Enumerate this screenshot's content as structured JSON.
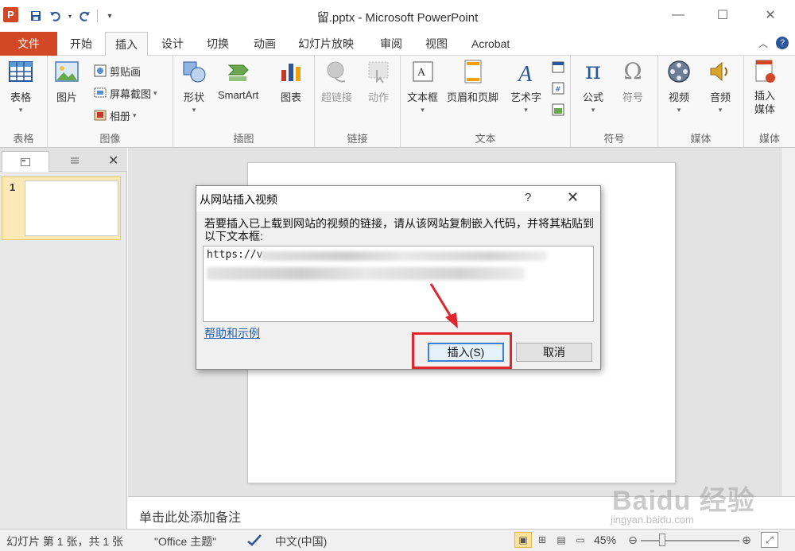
{
  "window": {
    "title": "留.pptx - Microsoft PowerPoint",
    "app_icon_letter": "P",
    "controls": {
      "minimize": "—",
      "maximize": "☐",
      "close": "✕"
    }
  },
  "ribbon_tabs": [
    "文件",
    "开始",
    "插入",
    "设计",
    "切换",
    "动画",
    "幻灯片放映",
    "审阅",
    "视图",
    "Acrobat"
  ],
  "active_tab": "插入",
  "ribbon": {
    "tables": {
      "label": "表格",
      "table": "表格"
    },
    "images": {
      "label": "图像",
      "picture": "图片",
      "clipart": "剪贴画",
      "screenshot": "屏幕截图",
      "album": "相册"
    },
    "illustrations": {
      "label": "插图",
      "shapes": "形状",
      "smartart": "SmartArt",
      "chart": "图表"
    },
    "links": {
      "label": "链接",
      "hyperlink": "超链接",
      "action": "动作"
    },
    "text": {
      "label": "文本",
      "textbox": "文本框",
      "header_footer": "页眉和页脚",
      "wordart": "艺术字"
    },
    "symbols": {
      "label": "符号",
      "equation": "公式",
      "symbol": "符号",
      "pi": "π",
      "omega": "Ω"
    },
    "media": {
      "label": "媒体",
      "video": "视频",
      "audio": "音频"
    },
    "insert_media": {
      "label": "媒体",
      "button": "插入\n媒体"
    }
  },
  "slide_panel": {
    "slide_number": "1"
  },
  "notes": {
    "placeholder": "单击此处添加备注"
  },
  "status_bar": {
    "slide_info": "幻灯片 第 1 张，共 1 张",
    "theme": "\"Office 主题\"",
    "language": "中文(中国)",
    "zoom": "45%",
    "zoom_level": 0.45
  },
  "dialog": {
    "title": "从网站插入视频",
    "help_glyph": "?",
    "close_glyph": "✕",
    "description": "若要插入已上载到网站的视频的链接，请从该网站复制嵌入代码，并将其粘贴到以下文本框:",
    "embed_value": "https://v",
    "help_link": "帮助和示例",
    "insert_button": "插入(S)",
    "cancel_button": "取消"
  },
  "watermark": {
    "brand": "Baidu 经验",
    "url": "jingyan.baidu.com"
  },
  "colors": {
    "file_tab": "#d24726",
    "accent_blue": "#2b579a",
    "highlight_red": "#e2252c",
    "link": "#1a5fb4"
  }
}
